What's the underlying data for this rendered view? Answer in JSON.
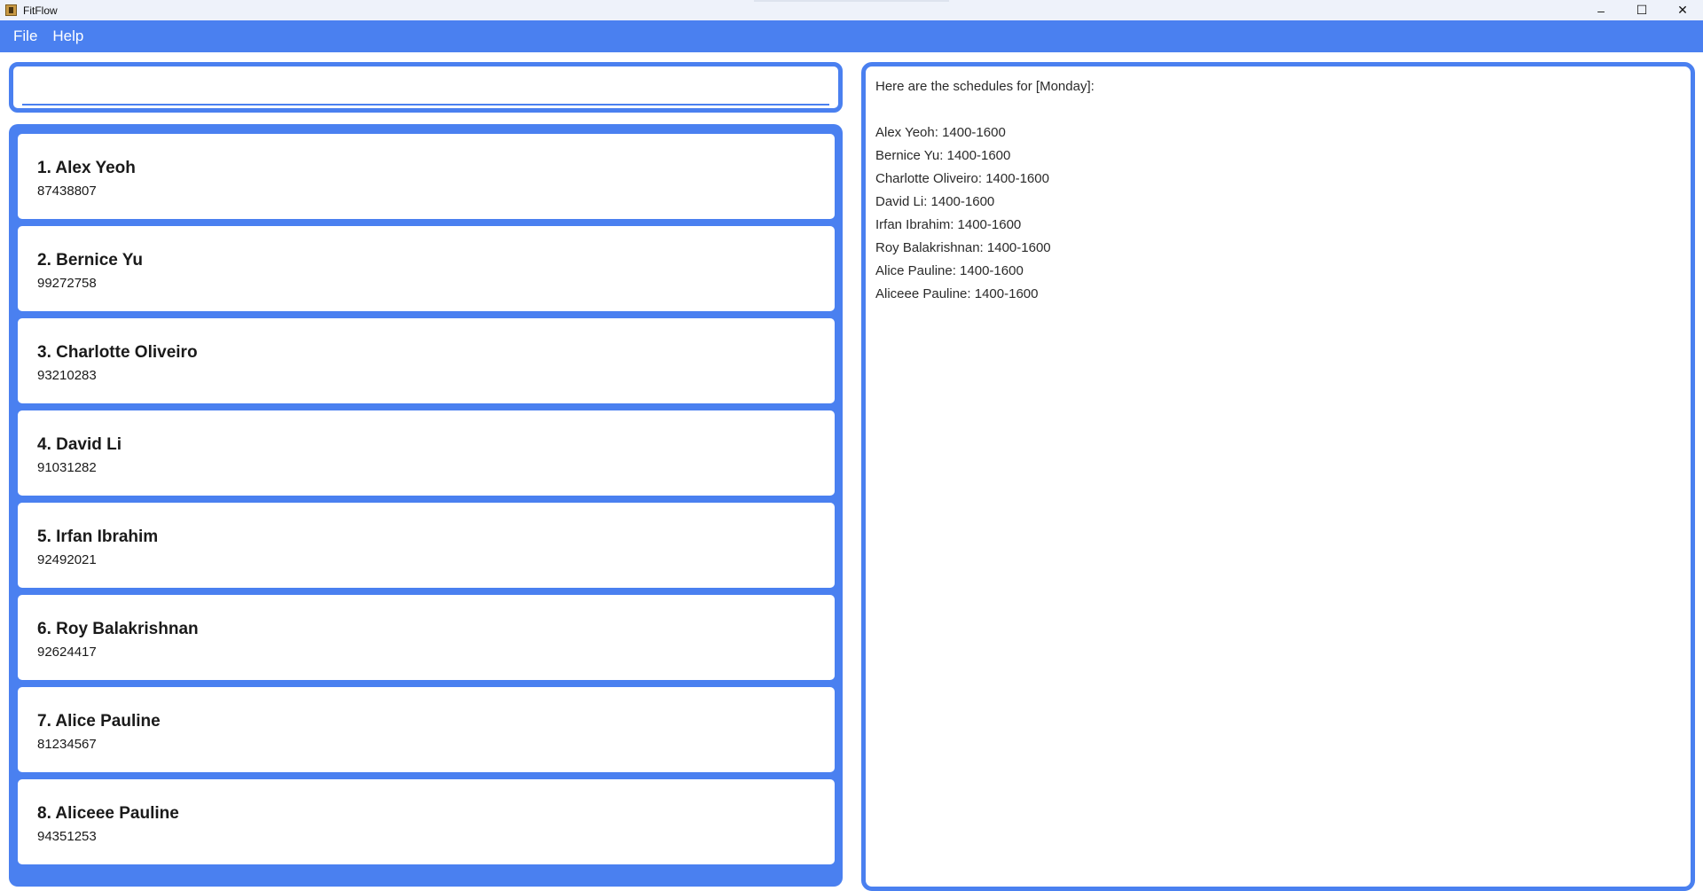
{
  "window": {
    "title": "FitFlow",
    "controls": [
      "–",
      "☐",
      "✕"
    ]
  },
  "menu": {
    "items": [
      "File",
      "Help"
    ]
  },
  "command": {
    "value": "",
    "placeholder": ""
  },
  "persons": [
    {
      "name": "1. Alex Yeoh",
      "phone": "87438807"
    },
    {
      "name": "2. Bernice Yu",
      "phone": "99272758"
    },
    {
      "name": "3. Charlotte Oliveiro",
      "phone": "93210283"
    },
    {
      "name": "4. David Li",
      "phone": "91031282"
    },
    {
      "name": "5. Irfan Ibrahim",
      "phone": "92492021"
    },
    {
      "name": "6. Roy Balakrishnan",
      "phone": "92624417"
    },
    {
      "name": "7. Alice Pauline",
      "phone": "81234567"
    },
    {
      "name": "8. Aliceee Pauline",
      "phone": "94351253"
    }
  ],
  "result": {
    "lines": [
      "Here are the schedules for [Monday]:",
      "",
      "Alex Yeoh: 1400-1600",
      "Bernice Yu: 1400-1600",
      "Charlotte Oliveiro: 1400-1600",
      "David Li: 1400-1600",
      "Irfan Ibrahim: 1400-1600",
      "Roy Balakrishnan: 1400-1600",
      "Alice Pauline: 1400-1600",
      "Aliceee Pauline: 1400-1600"
    ]
  },
  "colors": {
    "accent": "#4a80f0",
    "titlebar": "#eef2fa"
  }
}
